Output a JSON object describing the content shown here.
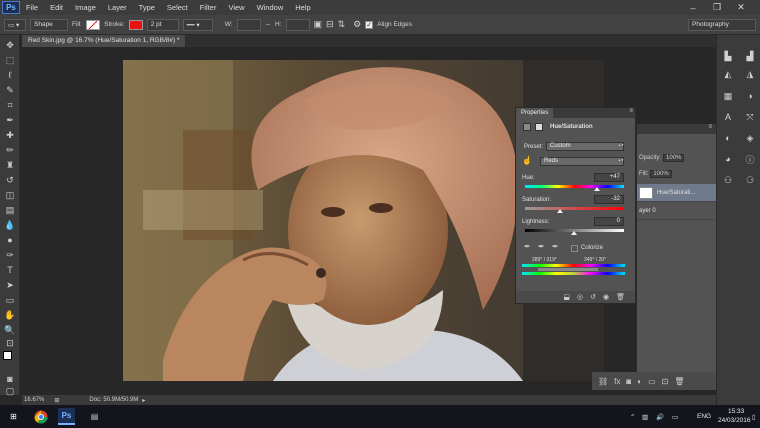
{
  "app": {
    "logo": "Ps"
  },
  "menu": {
    "items": [
      "File",
      "Edit",
      "Image",
      "Layer",
      "Type",
      "Select",
      "Filter",
      "View",
      "Window",
      "Help"
    ]
  },
  "options_bar": {
    "mode_value": "Shape",
    "fill_label": "Fill:",
    "stroke_label": "Stroke:",
    "stroke_width": "2 pt",
    "w_label": "W:",
    "h_label": "H:",
    "align_edges_label": "Align Edges",
    "align_edges_checked": true,
    "workspace_value": "Photography"
  },
  "document": {
    "tab_title": "Red Skin.jpg @ 16.7% (Hue/Saturation 1, RGB/8#) *"
  },
  "status": {
    "zoom": "16.67%",
    "doc_info": "Doc: 50.9M/50.9M"
  },
  "properties": {
    "tab": "Properties",
    "adjustment_title": "Hue/Saturation",
    "preset_label": "Preset:",
    "preset_value": "Custom",
    "channel_value": "Reds",
    "hue_label": "Hue:",
    "hue_value": "+47",
    "saturation_label": "Saturation:",
    "saturation_value": "-32",
    "lightness_label": "Lightness:",
    "lightness_value": "0",
    "colorize_label": "Colorize",
    "range_left": "289° / 319°",
    "range_right": "349° \\ 20°"
  },
  "layers": {
    "opacity_label": "Opacity:",
    "opacity_value": "100%",
    "fill_label": "Fill:",
    "fill_value": "100%",
    "rows": [
      {
        "name": "Hue/Saturati..."
      },
      {
        "name": "ayer 0"
      }
    ]
  },
  "taskbar": {
    "language": "ENG",
    "time": "15:33",
    "date": "24/03/2016"
  },
  "colors": {
    "stroke_swatch": "#e81414",
    "workspace_bg": "#282828",
    "panel_bg": "#535353",
    "taskbar_bg": "#12161c"
  }
}
